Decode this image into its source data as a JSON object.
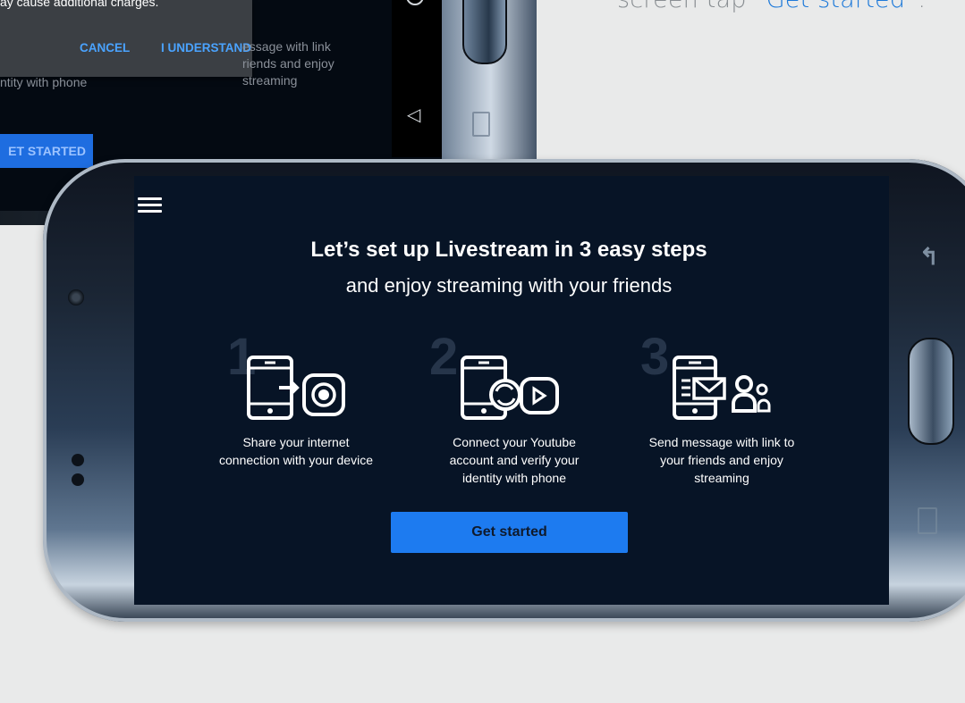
{
  "caption": {
    "prefix": "screen tap “",
    "link": "Get started",
    "suffix": "”."
  },
  "bg_app": {
    "dialog_text": "ay cause additional charges.",
    "cancel_label": "CANCEL",
    "understand_label": "I UNDERSTAND",
    "faded_left": "ntity with phone",
    "faded_mid": "essage with link\nriends and enjoy\nstreaming",
    "get_started_label": "ET STARTED"
  },
  "app": {
    "title": "Let’s set up Livestream in 3 easy steps",
    "subtitle": "and enjoy streaming with your friends",
    "steps": [
      {
        "number": "1",
        "text": "Share your internet connection with your device",
        "icon": "phone-share-icon"
      },
      {
        "number": "2",
        "text": "Connect your Youtube account and verify your identity with phone",
        "icon": "phone-sync-icon"
      },
      {
        "number": "3",
        "text": "Send message with link to your friends and enjoy streaming",
        "icon": "phone-message-icon"
      }
    ],
    "cta_label": "Get started"
  },
  "colors": {
    "accent": "#1d7bf0",
    "screen_bg": "#071426",
    "caption_link": "#1f7ad9"
  }
}
